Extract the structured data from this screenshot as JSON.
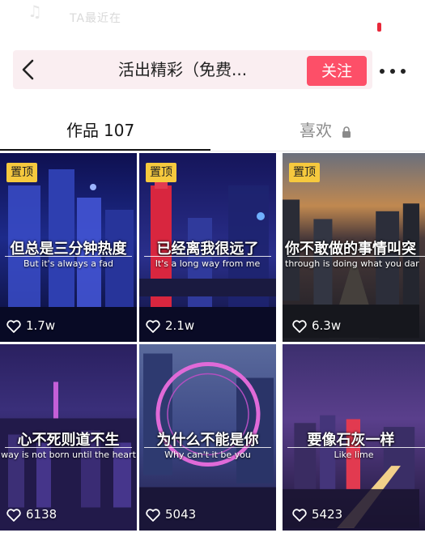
{
  "status": {
    "ghost_text": "TA最近在"
  },
  "header": {
    "title": "活出精彩（免费...",
    "follow_label": "关注"
  },
  "tabs": [
    {
      "label": "作品",
      "count": "107",
      "active": true
    },
    {
      "label": "喜欢",
      "locked": true,
      "active": false
    }
  ],
  "videos": [
    {
      "pinned": true,
      "pin_label": "置顶",
      "caption_cn": "但总是三分钟热度",
      "caption_en": "But it's always a fad",
      "likes": "1.7w"
    },
    {
      "pinned": true,
      "pin_label": "置顶",
      "caption_cn": "已经离我很远了",
      "caption_en": "It's a long way from me",
      "likes": "2.1w"
    },
    {
      "pinned": true,
      "pin_label": "置顶",
      "caption_cn": "你不敢做的事情叫突",
      "caption_en": "through is doing what you dar",
      "likes": "6.3w"
    },
    {
      "pinned": false,
      "caption_cn": "心不死则道不生",
      "caption_en": "way is not born until the heart",
      "likes": "6138"
    },
    {
      "pinned": false,
      "caption_cn": "为什么不能是你",
      "caption_en": "Why can't it be you",
      "likes": "5043"
    },
    {
      "pinned": false,
      "caption_cn": "要像石灰一样",
      "caption_en": "Like lime",
      "likes": "5423"
    }
  ],
  "colors": {
    "accent": "#fd4f68",
    "pin": "#f6c93e"
  }
}
